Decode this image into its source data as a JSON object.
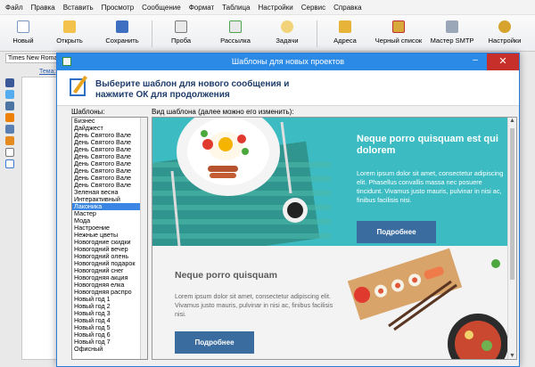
{
  "menu": [
    "Файл",
    "Правка",
    "Вставить",
    "Просмотр",
    "Сообщение",
    "Формат",
    "Таблица",
    "Настройки",
    "Сервис",
    "Справка"
  ],
  "toolbar": {
    "new": "Новый",
    "open": "Открыть",
    "save": "Сохранить",
    "trial": "Проба",
    "mailing": "Рассылка",
    "tasks": "Задачи",
    "addresses": "Адреса",
    "blacklist": "Черный список",
    "smtp": "Мастер SMTP",
    "settings": "Настройки"
  },
  "editor": {
    "font": "Times New Roman",
    "subject_label": "Тема:"
  },
  "dialog": {
    "title": "Шаблоны для новых проектов",
    "header_line1": "Выберите шаблон для нового сообщения и",
    "header_line2": "нажмите ОК для продолжения",
    "templates_label": "Шаблоны:",
    "preview_label": "Вид шаблона (далее можно его изменить):",
    "templates": [
      "Бизнес",
      "Дайджест",
      "День Святого Вале",
      "День Святого Вале",
      "День Святого Вале",
      "День Святого Вале",
      "День Святого Вале",
      "День Святого Вале",
      "День Святого Вале",
      "День Святого Вале",
      "Зеленая весна",
      "Интерактивный",
      "Лаконика",
      "Мастер",
      "Мода",
      "Настроение",
      "Нежные цветы",
      "Новогодние скидки",
      "Новогодний вечер",
      "Новогодний олень",
      "Новогодний подарок",
      "Новогодний снег",
      "Новогодняя акция",
      "Новогодняя елка",
      "Новогодняя распро",
      "Новый год 1",
      "Новый год 2",
      "Новый год 3",
      "Новый год 4",
      "Новый год 5",
      "Новый год 6",
      "Новый год 7",
      "Офисный"
    ],
    "selected_index": 12,
    "preview": {
      "block1_title": "Neque porro quisquam est qui dolorem",
      "block1_text": "Lorem ipsum dolor sit amet, consectetur adipiscing elit. Phasellus convallis massa nec posuere tincidunt. Vivamus justo mauris, pulvinar in nisi ac, finibus facilisis nisi.",
      "block1_button": "Подробнее",
      "block2_title": "Neque porro quisquam",
      "block2_text": "Lorem ipsum dolor sit amet, consectetur adipiscing elit. Vivamus justo mauris, pulvinar in nisi ac, finibus facilisis nisi.",
      "block2_button": "Подробнее"
    }
  },
  "colors": {
    "titlebar": "#2b8ae6",
    "close": "#c7302a",
    "teal": "#3cbcc2",
    "button": "#3a6c9f",
    "selection": "#3b86e2"
  }
}
